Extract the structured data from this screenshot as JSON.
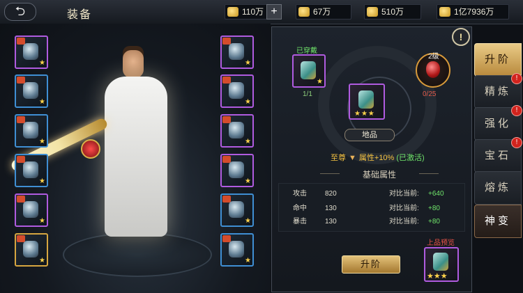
{
  "header": {
    "title": "装备",
    "back_icon": "back-arrow-icon",
    "resources": [
      {
        "name": "gold-ingot",
        "value": "110万"
      },
      {
        "name": "bound-gold",
        "value": "67万"
      },
      {
        "name": "coin",
        "value": "510万"
      },
      {
        "name": "silver",
        "value": "1亿7936万"
      }
    ],
    "plus_label": "+"
  },
  "equipment": {
    "left_slots": [
      "purple",
      "blue",
      "blue",
      "blue",
      "purple",
      "gold"
    ],
    "right_slots": [
      "purple",
      "purple",
      "purple",
      "purple",
      "blue",
      "blue"
    ]
  },
  "upgrade": {
    "info_label": "!",
    "equipped_label": "已穿戴",
    "equipped_count": "1/1",
    "stone_level": "2级",
    "stone_count": "0/25",
    "grade_label": "地品",
    "tier_name": "至尊",
    "tier_attr": "属性+10%",
    "tier_status": "(已激活)",
    "section_title": "基础属性",
    "stats": [
      {
        "name": "攻击",
        "value": "820",
        "compare": "对比当前:",
        "delta": "+640"
      },
      {
        "name": "命中",
        "value": "130",
        "compare": "对比当前:",
        "delta": "+80"
      },
      {
        "name": "暴击",
        "value": "130",
        "compare": "对比当前:",
        "delta": "+80"
      }
    ],
    "upgrade_button": "升阶",
    "preview_label": "上品预览",
    "center_stars": "★★★",
    "preview_stars": "★★★"
  },
  "tabs": [
    {
      "label": "升阶",
      "state": "active",
      "alert": false
    },
    {
      "label": "精炼",
      "state": "normal",
      "alert": true
    },
    {
      "label": "强化",
      "state": "normal",
      "alert": true
    },
    {
      "label": "宝石",
      "state": "normal",
      "alert": true
    },
    {
      "label": "熔炼",
      "state": "normal",
      "alert": false
    },
    {
      "label": "神变",
      "state": "selected",
      "alert": false
    }
  ],
  "alert_mark": "!",
  "colors": {
    "accent": "#e9cb87",
    "positive": "#6fe36a",
    "warning": "#d2231d",
    "purple_rarity": "#b05be0",
    "blue_rarity": "#3f8fd4"
  }
}
